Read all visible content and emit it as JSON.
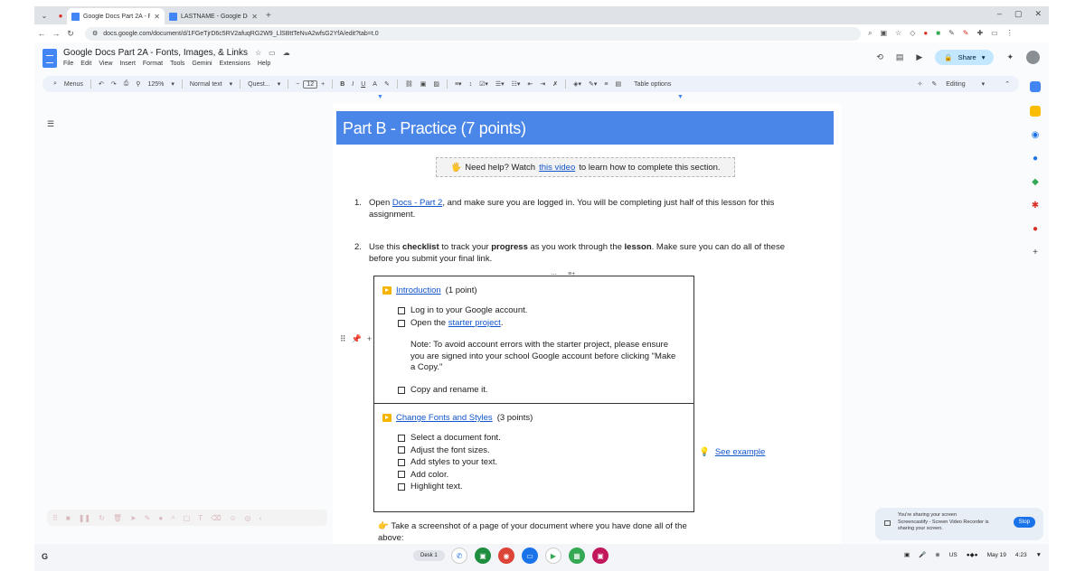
{
  "browser": {
    "tabs": [
      {
        "title": "Google Docs Part 2A - Fonts, Im...",
        "active": true
      },
      {
        "title": "LASTNAME - Google Docs Part...",
        "active": false
      }
    ],
    "url": "docs.google.com/document/d/1FGeTjrD6c5RV2afuqRG2W9_LlSBttTeNvA2wfsG2YfA/edit?tab=t.0"
  },
  "docs": {
    "title": "Google Docs Part 2A - Fonts, Images, & Links",
    "menu": [
      "File",
      "Edit",
      "View",
      "Insert",
      "Format",
      "Tools",
      "Gemini",
      "Extensions",
      "Help"
    ],
    "share_label": "Share",
    "toolbar": {
      "menus_label": "Menus",
      "zoom": "125%",
      "style": "Normal text",
      "font": "Quest...",
      "font_size": "12",
      "table_options": "Table options",
      "mode": "Editing"
    }
  },
  "document": {
    "heading": "Part B - Practice (7 points)",
    "help": {
      "emoji": "🖐",
      "before": "Need help? Watch",
      "link": "this video",
      "after": "to learn how to complete this section."
    },
    "item1": {
      "num": "1.",
      "before": "Open",
      "link": "Docs - Part 2",
      "after": ", and make sure you are logged in. You will be completing just half of this lesson for this assignment."
    },
    "item2": {
      "num": "2.",
      "t1": "Use this",
      "b1": "checklist",
      "t2": "to track your",
      "b2": "progress",
      "t3": "as you work through the",
      "b3": "lesson",
      "t4": ". Make sure you can do all of these before you submit your final link."
    },
    "section1": {
      "link": "Introduction",
      "points": "(1 point)",
      "item_login": "Log in to your Google account.",
      "item_open_before": "Open the",
      "item_open_link": "starter project",
      "item_open_after": ".",
      "note": "Note: To avoid account errors with the starter project, please ensure you are signed into your school Google account before clicking \"Make a Copy.\"",
      "item_copy": "Copy and rename it."
    },
    "section2": {
      "link": "Change Fonts and Styles",
      "points": "(3 points)",
      "items": [
        "Select a document font.",
        "Adjust the font sizes.",
        "Add styles to your text.",
        "Add color.",
        "Highlight text."
      ]
    },
    "example": {
      "emoji": "💡",
      "link": "See example"
    },
    "screenshot": {
      "emoji": "👉",
      "text": "Take a screenshot of a page of your document where you have done all of the above:"
    }
  },
  "toast": {
    "line1": "You're sharing your screen",
    "line2": "Screencastify - Screen Video Recorder is sharing your screen.",
    "stop": "Stop"
  },
  "shelf": {
    "desk": "Desk 1",
    "locale": "US",
    "date": "May 19",
    "time": "4:23"
  }
}
